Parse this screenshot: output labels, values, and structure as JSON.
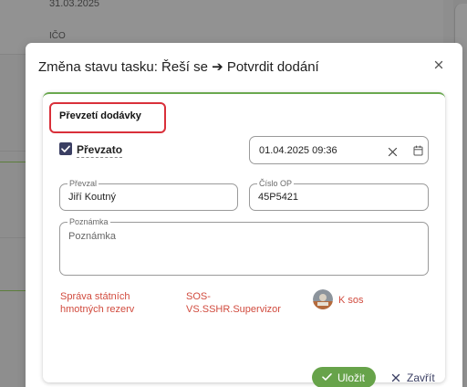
{
  "background": {
    "date": "31.03.2025",
    "ico_label": "IČO"
  },
  "dialog": {
    "title": "Změna stavu tasku: Řeší se ➔ Potvrdit dodání",
    "close_icon": "close-icon",
    "section": {
      "title": "Převzetí dodávky",
      "received": {
        "label": "Převzato",
        "checked": true
      },
      "datetime": {
        "value": "01.04.2025 09:36",
        "icons": [
          "clear-icon",
          "calendar-icon"
        ]
      },
      "received_by": {
        "label": "Převzal",
        "value": "Jiří Koutný"
      },
      "op_number": {
        "label": "Číslo OP",
        "value": "45P5421"
      },
      "note": {
        "label": "Poznámka",
        "placeholder": "Poznámka"
      },
      "organization": {
        "line1": "Správa státních",
        "line2": "hmotných rezerv"
      },
      "role": {
        "line1": "SOS-",
        "line2": "VS.SSHR.Supervizor"
      },
      "assignee": "K sos"
    },
    "buttons": {
      "save": "Uložit",
      "close": "Zavřít"
    }
  },
  "colors": {
    "accent_green": "#67a34a",
    "highlight_red": "#d9303a",
    "link_red": "#d14b3e",
    "checkbox": "#3b3f63"
  }
}
